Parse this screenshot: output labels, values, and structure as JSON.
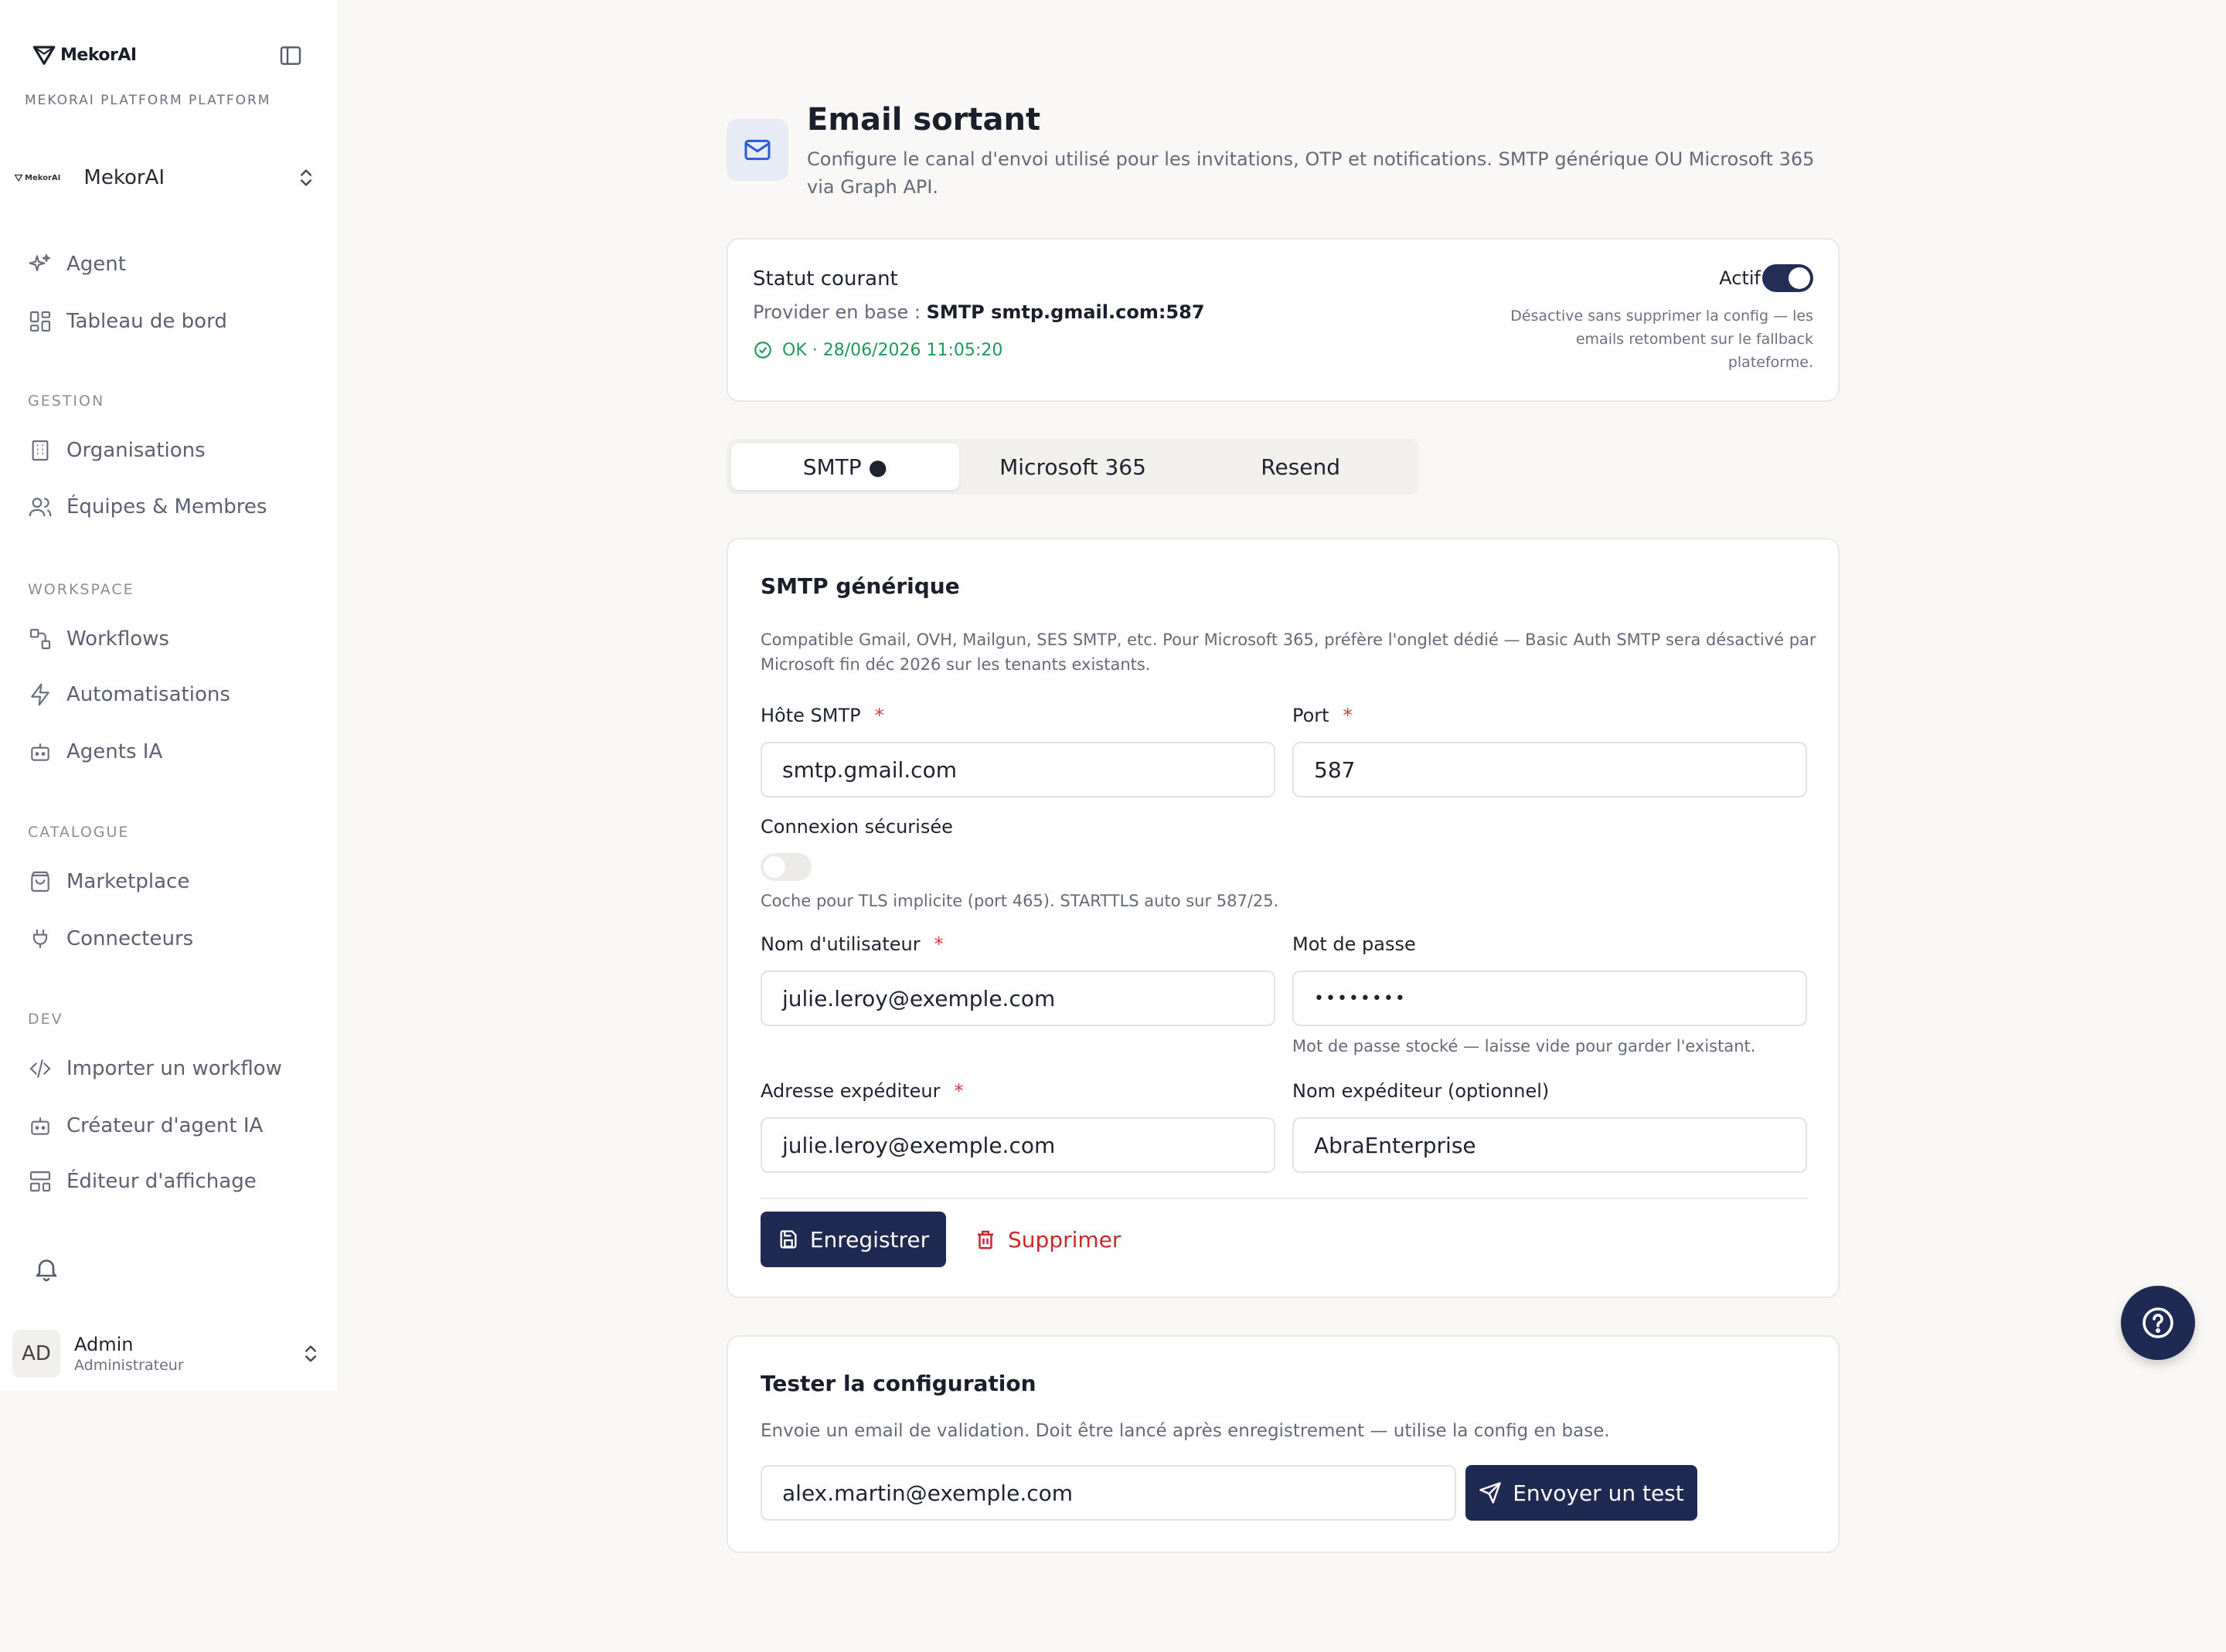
{
  "sidebar": {
    "brand": "MekorAI",
    "platform_label": "MEKORAI PLATFORM PLATFORM",
    "org": {
      "mini_logo": "MekorAI",
      "name": "MekorAI"
    },
    "top_items": [
      {
        "label": "Agent",
        "icon": "sparkles-icon"
      },
      {
        "label": "Tableau de bord",
        "icon": "dashboard-icon"
      }
    ],
    "sections": [
      {
        "label": "GESTION",
        "items": [
          {
            "label": "Organisations",
            "icon": "building-icon"
          },
          {
            "label": "Équipes & Membres",
            "icon": "users-icon"
          }
        ]
      },
      {
        "label": "WORKSPACE",
        "items": [
          {
            "label": "Workflows",
            "icon": "workflow-icon"
          },
          {
            "label": "Automatisations",
            "icon": "lightning-icon"
          },
          {
            "label": "Agents IA",
            "icon": "bot-icon"
          }
        ]
      },
      {
        "label": "CATALOGUE",
        "items": [
          {
            "label": "Marketplace",
            "icon": "shopping-bag-icon"
          },
          {
            "label": "Connecteurs",
            "icon": "plug-icon"
          }
        ]
      },
      {
        "label": "DEV",
        "items": [
          {
            "label": "Importer un workflow",
            "icon": "code-icon"
          },
          {
            "label": "Créateur d'agent IA",
            "icon": "bot-icon"
          },
          {
            "label": "Éditeur d'affichage",
            "icon": "layout-icon"
          }
        ]
      }
    ],
    "user": {
      "initials": "AD",
      "name": "Admin",
      "role": "Administrateur"
    }
  },
  "header": {
    "title": "Email sortant",
    "description": "Configure le canal d'envoi utilisé pour les invitations, OTP et notifications. SMTP générique OU Microsoft 365 via Graph API."
  },
  "status": {
    "title": "Statut courant",
    "provider_prefix": "Provider en base : ",
    "provider_value": "SMTP smtp.gmail.com:587",
    "ok_text": "OK · 28/06/2026 11:05:20",
    "active_label": "Actif",
    "active": true,
    "note": "Désactive sans supprimer la config — les emails retombent sur le fallback plateforme.",
    "ok_color": "#1f9a5a"
  },
  "tabs": [
    {
      "label": "SMTP ●",
      "active": true
    },
    {
      "label": "Microsoft 365",
      "active": false
    },
    {
      "label": "Resend",
      "active": false
    }
  ],
  "smtp": {
    "title": "SMTP générique",
    "description": "Compatible Gmail, OVH, Mailgun, SES SMTP, etc. Pour Microsoft 365, préfère l'onglet dédié — Basic Auth SMTP sera désactivé par Microsoft fin déc 2026 sur les tenants existants.",
    "host_label": "Hôte SMTP",
    "host_value": "smtp.gmail.com",
    "port_label": "Port",
    "port_value": "587",
    "secure_label": "Connexion sécurisée",
    "secure_on": false,
    "secure_hint": "Coche pour TLS implicite (port 465). STARTTLS auto sur 587/25.",
    "user_label": "Nom d'utilisateur",
    "user_value": "julie.leroy@exemple.com",
    "password_label": "Mot de passe",
    "password_value": "••••••••",
    "password_hint": "Mot de passe stocké — laisse vide pour garder l'existant.",
    "from_label": "Adresse expéditeur",
    "from_value": "julie.leroy@exemple.com",
    "from_name_label": "Nom expéditeur (optionnel)",
    "from_name_value": "AbraEnterprise",
    "required_mark": "*",
    "save_label": "Enregistrer",
    "delete_label": "Supprimer"
  },
  "test": {
    "title": "Tester la configuration",
    "description": "Envoie un email de validation. Doit être lancé après enregistrement — utilise la config en base.",
    "email_value": "alex.martin@exemple.com",
    "send_label": "Envoyer un test"
  },
  "colors": {
    "primary": "#1f2a52",
    "danger": "#c92a2a",
    "success": "#1f9a5a"
  }
}
